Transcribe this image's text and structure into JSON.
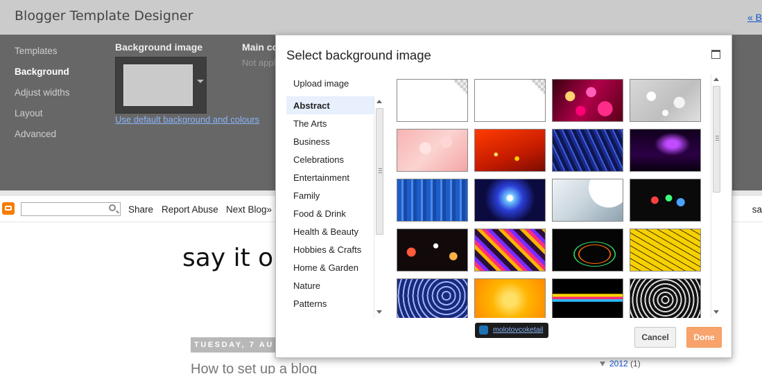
{
  "designer": {
    "title": "Blogger Template Designer",
    "back_link": "« B",
    "nav": [
      "Templates",
      "Background",
      "Adjust widths",
      "Layout",
      "Advanced"
    ],
    "active_nav": "Background",
    "background_heading": "Background image",
    "default_link": "Use default background and colours",
    "main_heading": "Main co",
    "main_sub": "Not appl"
  },
  "navbar": {
    "share": "Share",
    "report": "Report Abuse",
    "next": "Next Blog»",
    "right": "sa"
  },
  "blog": {
    "title": "say it or",
    "date": "TUESDAY, 7 AU",
    "post_title": "How to set up a blog",
    "archive_year": "2012",
    "archive_count": "(1)"
  },
  "dialog": {
    "title": "Select background image",
    "upload": "Upload image",
    "categories": [
      "Abstract",
      "The Arts",
      "Business",
      "Celebrations",
      "Entertainment",
      "Family",
      "Food & Drink",
      "Health & Beauty",
      "Hobbies & Crafts",
      "Home & Garden",
      "Nature",
      "Patterns"
    ],
    "selected_category": "Abstract",
    "credit": "molotovcoketail",
    "cancel": "Cancel",
    "done": "Done",
    "colors": {
      "done_bg": "#f7a36b",
      "selected_bg": "#e8f0fe",
      "link": "#8ab4f8"
    }
  }
}
